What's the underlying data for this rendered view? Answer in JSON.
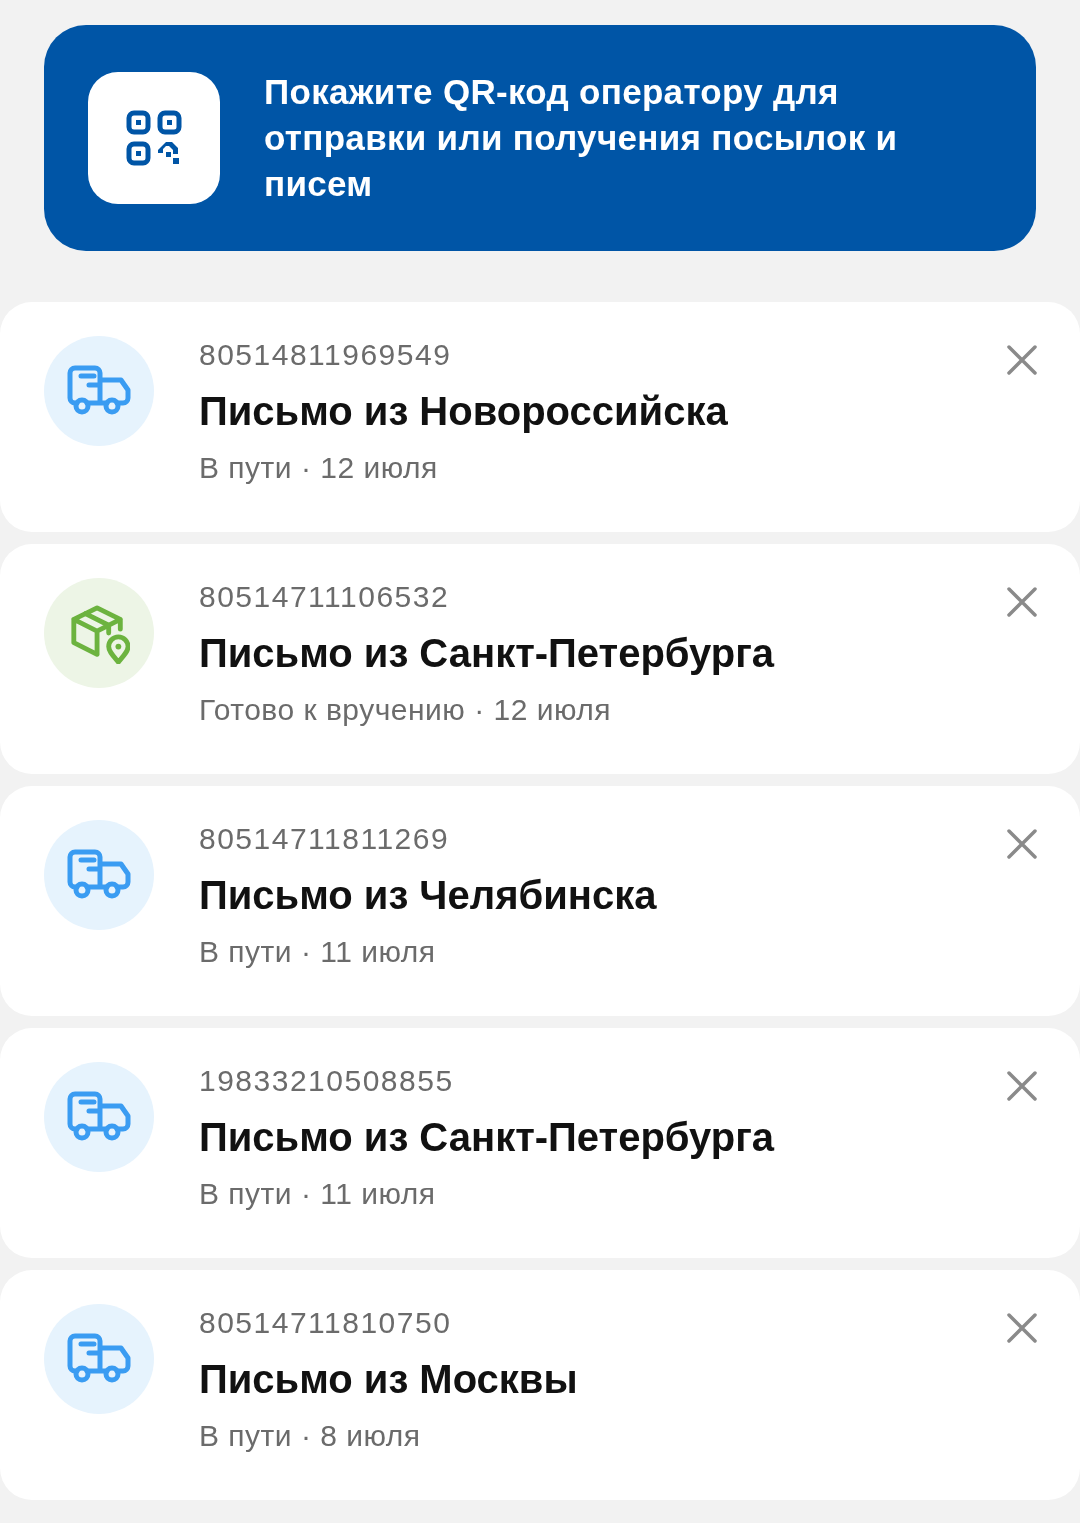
{
  "banner": {
    "text": "Покажите QR-код оператору для отправки или получения посылок и писем"
  },
  "shipments": [
    {
      "kind": "in_transit",
      "tracking_number": "80514811969549",
      "title": "Письмо из Новороссийска",
      "status": "В пути · 12 июля"
    },
    {
      "kind": "ready",
      "tracking_number": "80514711106532",
      "title": "Письмо из Санкт-Петербурга",
      "status": "Готово к вручению · 12 июля"
    },
    {
      "kind": "in_transit",
      "tracking_number": "80514711811269",
      "title": "Письмо из Челябинска",
      "status": "В пути · 11 июля"
    },
    {
      "kind": "in_transit",
      "tracking_number": "19833210508855",
      "title": "Письмо из Санкт-Петербурга",
      "status": "В пути · 11 июля"
    },
    {
      "kind": "in_transit",
      "tracking_number": "80514711810750",
      "title": "Письмо из Москвы",
      "status": "В пути · 8 июля"
    }
  ]
}
